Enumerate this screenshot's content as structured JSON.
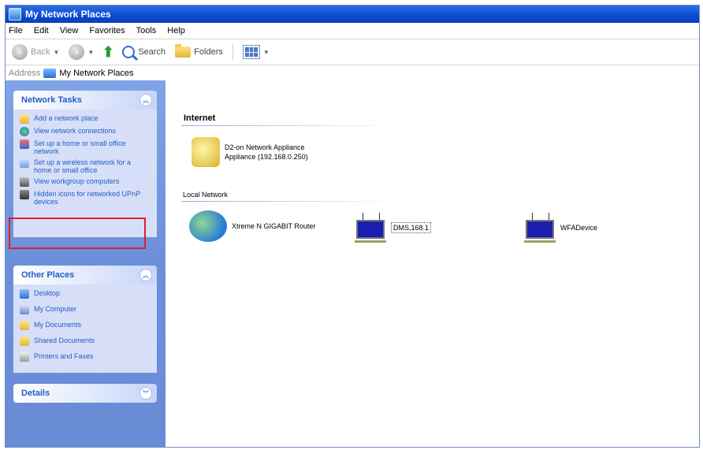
{
  "window": {
    "title": "My Network Places"
  },
  "menu": [
    "File",
    "Edit",
    "View",
    "Favorites",
    "Tools",
    "Help"
  ],
  "toolbar": {
    "back_label": "Back",
    "search_label": "Search",
    "folders_label": "Folders"
  },
  "address": {
    "label": "Address",
    "value": "My Network Places"
  },
  "sidebar": {
    "network_tasks": {
      "title": "Network Tasks",
      "items": [
        "Add a network place",
        "View network connections",
        "Set up a home or small office network",
        "Set up a wireless network for a home or small office",
        "View workgroup computers",
        "Hidden icons for networked UPnP devices"
      ]
    },
    "other_places": {
      "title": "Other Places",
      "items": [
        "Desktop",
        "My Computer",
        "My Documents",
        "Shared Documents",
        "Printers and Faxes"
      ]
    },
    "details": {
      "title": "Details"
    }
  },
  "main": {
    "internet": {
      "heading": "Internet",
      "item_line1": "D2-on Network Appliance",
      "item_line2": "Appliance (192.168.0.250)"
    },
    "local": {
      "heading": "Local Network",
      "items": [
        "Xtreme N GIGABIT Router",
        "DMS,168.1",
        "WFADevice"
      ]
    }
  }
}
